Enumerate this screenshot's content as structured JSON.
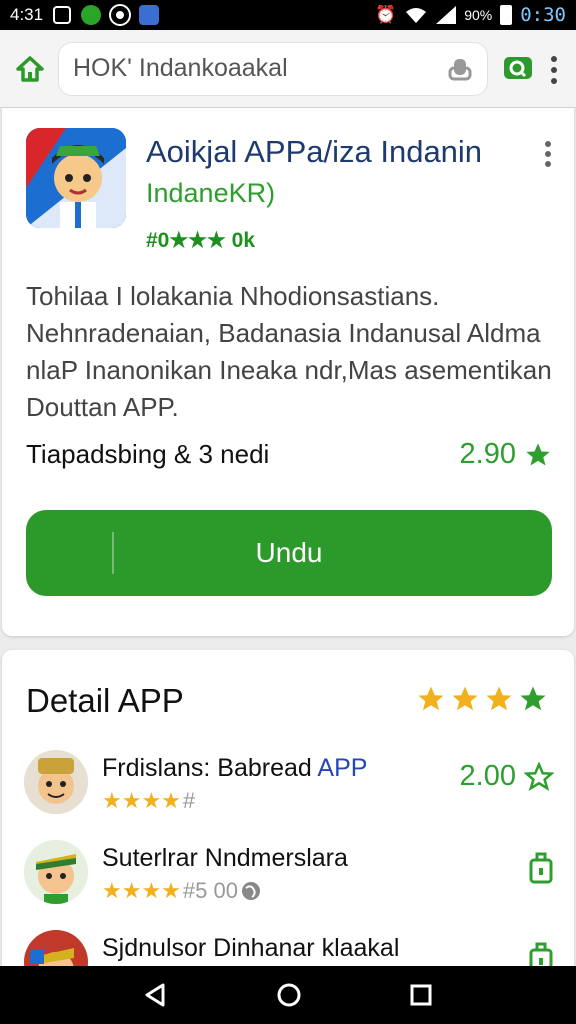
{
  "status_bar": {
    "left_text": "4:31",
    "battery_percent": "90%",
    "time": "0:30"
  },
  "browser": {
    "url": "HOK' Indankoaakal"
  },
  "app": {
    "title": "Aoikjal APPa/iza Indanin",
    "developer": "IndaneKR)",
    "badge": "#0★★★ 0k",
    "description": "Tohilaa I lolakania Nhodionsastians. Nehnradenaian, Badanasia Indanusal Aldma nlaP Inanonikan Ineaka ndr,Mas asementikan Douttan APP.",
    "meta_text": "Tiapadsbing & 3 nedi",
    "rating": "2.90",
    "download_label": "Undu"
  },
  "detail": {
    "title": "Detail APP",
    "stars": 4,
    "items": [
      {
        "name": "Frdislans: Babread ",
        "name_highlight": "APP",
        "stars_label": "#",
        "right_value": "2.00"
      },
      {
        "name": "Suterlrar Nndmerslara",
        "name_highlight": "",
        "stars_label": "#5 00",
        "right_value": ""
      },
      {
        "name": "Sjdnulsor Dinhanar klaakal",
        "name_highlight": "",
        "stars_label": "",
        "right_value": ""
      }
    ]
  },
  "colors": {
    "accent_green": "#2b9a2b",
    "star_gold": "#f2b01e",
    "star_green": "#2e9e2e",
    "title_blue": "#1e3a6e"
  }
}
